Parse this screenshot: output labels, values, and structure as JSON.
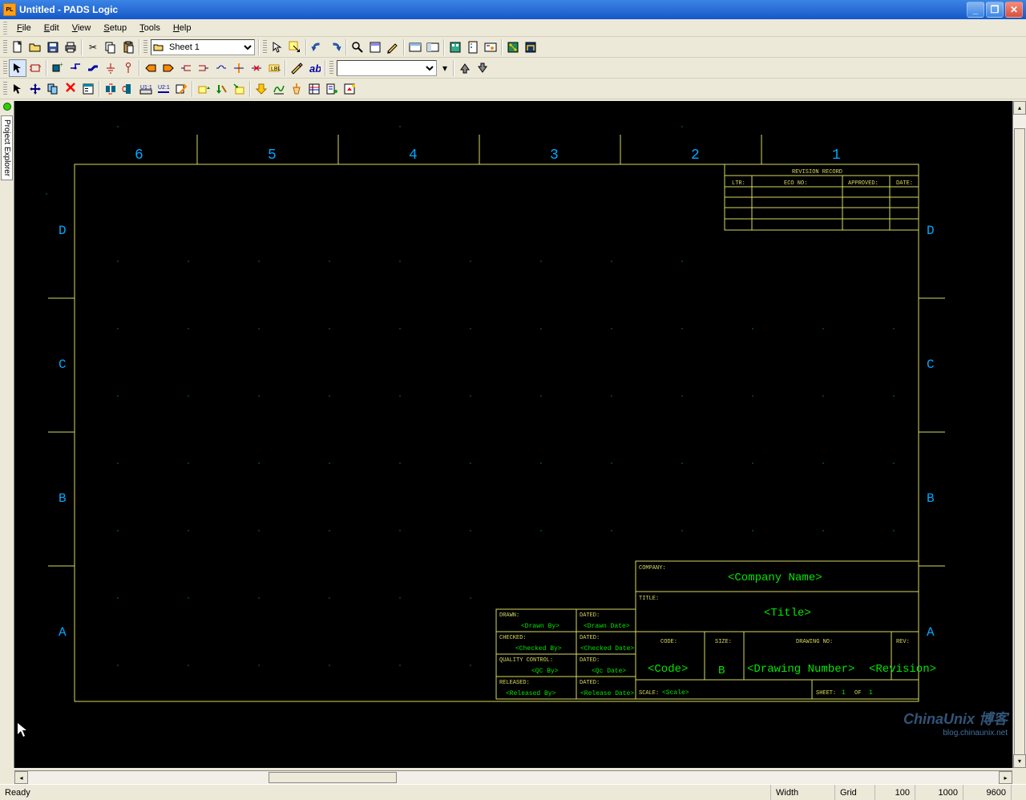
{
  "window": {
    "title": "Untitled - PADS Logic"
  },
  "menus": {
    "file": "File",
    "edit": "Edit",
    "view": "View",
    "setup": "Setup",
    "tools": "Tools",
    "help": "Help"
  },
  "toolbar1": {
    "sheet_selected": "Sheet 1"
  },
  "sidetab": {
    "label": "Project Explorer"
  },
  "schematic": {
    "columns": [
      "6",
      "5",
      "4",
      "3",
      "2",
      "1"
    ],
    "rows": [
      "D",
      "C",
      "B",
      "A"
    ],
    "revision": {
      "header": "REVISION RECORD",
      "cols": [
        "LTR:",
        "ECO NO:",
        "APPROVED:",
        "DATE:"
      ]
    },
    "titleblock": {
      "company_label": "COMPANY:",
      "company_value": "<Company Name>",
      "title_label": "TITLE:",
      "title_value": "<Title>",
      "drawn_label": "DRAWN:",
      "drawn_value": "<Drawn By>",
      "dated_label": "DATED:",
      "drawn_date": "<Drawn Date>",
      "checked_label": "CHECKED:",
      "checked_value": "<Checked By>",
      "checked_date": "<Checked Date>",
      "qc_label": "QUALITY CONTROL:",
      "qc_value": "<QC By>",
      "qc_date": "<Qc Date>",
      "released_label": "RELEASED:",
      "released_value": "<Released By>",
      "released_date": "<Release Date>",
      "code_label": "CODE:",
      "code_value": "<Code>",
      "size_label": "SIZE:",
      "size_value": "B",
      "dwgno_label": "DRAWING NO:",
      "dwgno_value": "<Drawing Number>",
      "rev_label": "REV:",
      "rev_value": "<Revision>",
      "scale_label": "SCALE:",
      "scale_value": "<Scale>",
      "sheet_label": "SHEET:",
      "sheet_value": "1",
      "sheet_of": "OF",
      "sheet_total": "1"
    }
  },
  "status": {
    "ready": "Ready",
    "width_label": "Width",
    "grid_label": "Grid",
    "grid_value": "100",
    "x": "1000",
    "y": "9600"
  },
  "watermark": {
    "main": "ChinaUnix 博客",
    "sub": "blog.chinaunix.net"
  }
}
